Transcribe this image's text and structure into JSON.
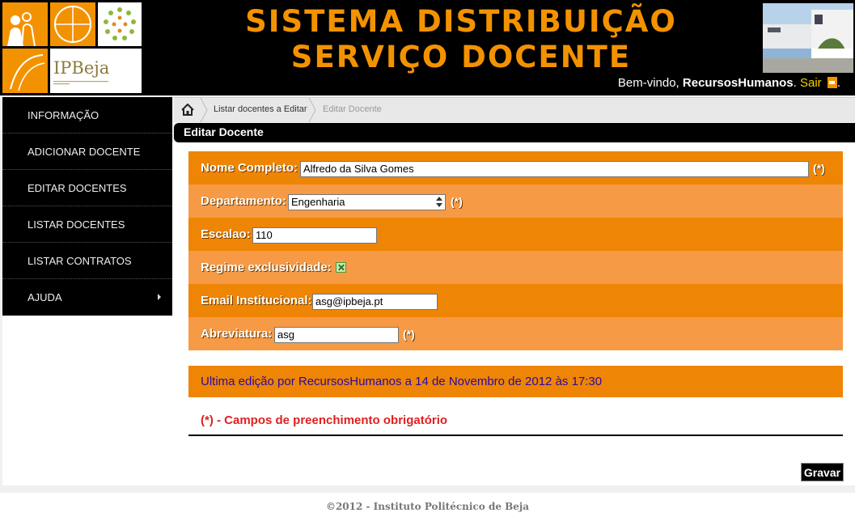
{
  "header": {
    "title_line1": "SISTEMA DISTRIBUIÇÃO",
    "title_line2": "SERVIÇO DOCENTE",
    "logo_text": "IPBeja",
    "welcome_prefix": "Bem-vindo, ",
    "username": "RecursosHumanos",
    "welcome_mid": ". ",
    "logout_label": "Sair",
    "welcome_suffix": "."
  },
  "sidebar": {
    "items": [
      {
        "label": "Informação"
      },
      {
        "label": "Adicionar Docente"
      },
      {
        "label": "Editar Docentes"
      },
      {
        "label": "Listar Docentes"
      },
      {
        "label": "Listar Contratos"
      },
      {
        "label": "Ajuda"
      }
    ]
  },
  "breadcrumb": {
    "items": [
      "Listar docentes a Editar",
      "Editar Docente"
    ]
  },
  "section_title": "Editar Docente",
  "form": {
    "nome_label": "Nome Completo:",
    "nome_value": "Alfredo da Silva Gomes",
    "departamento_label": "Departamento:",
    "departamento_value": "Engenharia",
    "escalao_label": "Escalao:",
    "escalao_value": "110",
    "regime_label": "Regime exclusividade:",
    "regime_checked": true,
    "email_label": "Email Institucional:",
    "email_value": "asg@ipbeja.pt",
    "abreviatura_label": "Abreviatura:",
    "abreviatura_value": "asg",
    "required_marker": "(*)"
  },
  "edit_info": "Ultima edição por RecursosHumanos a 14 de Novembro de 2012 às 17:30",
  "required_note": "(*) - Campos de preenchimento obrigatório",
  "save_label": "Gravar",
  "footer": "©2012 - Instituto Politécnico de Beja",
  "colors": {
    "accent": "#f39200",
    "row_dark": "#ef8505",
    "row_light": "#f69a45",
    "edit_info_text": "#2a0aa0",
    "required_text": "#e0201e"
  }
}
